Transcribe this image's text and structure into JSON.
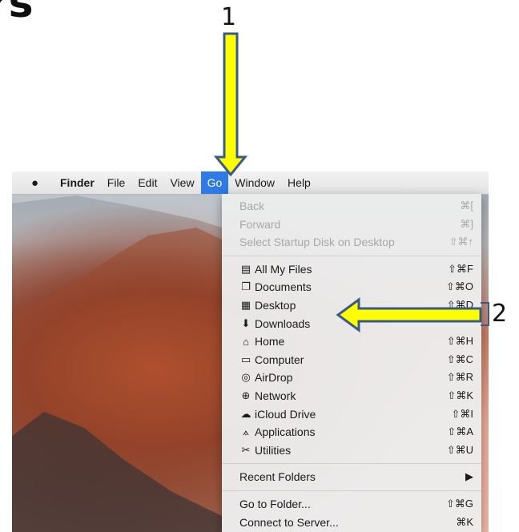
{
  "heading_fragment": "rs",
  "menubar": {
    "apple_icon": "apple-logo-icon",
    "items": [
      {
        "label": "Finder",
        "bold": true
      },
      {
        "label": "File"
      },
      {
        "label": "Edit"
      },
      {
        "label": "View"
      },
      {
        "label": "Go",
        "active": true
      },
      {
        "label": "Window"
      },
      {
        "label": "Help"
      }
    ]
  },
  "go_menu": {
    "items": [
      {
        "label": "Back",
        "shortcut": "⌘[",
        "disabled": true
      },
      {
        "label": "Forward",
        "shortcut": "⌘]",
        "disabled": true
      },
      {
        "label": "Select Startup Disk on Desktop",
        "shortcut": "⇧⌘↑",
        "disabled": true
      },
      {
        "separator": true
      },
      {
        "label": "All My Files",
        "shortcut": "⇧⌘F",
        "icon": "all-files-icon",
        "glyph": "▤"
      },
      {
        "label": "Documents",
        "shortcut": "⇧⌘O",
        "icon": "documents-icon",
        "glyph": "❐"
      },
      {
        "label": "Desktop",
        "shortcut": "⇧⌘D",
        "icon": "desktop-icon",
        "glyph": "▦"
      },
      {
        "label": "Downloads",
        "shortcut": "",
        "icon": "downloads-icon",
        "glyph": "⬇"
      },
      {
        "label": "Home",
        "shortcut": "⇧⌘H",
        "icon": "home-icon",
        "glyph": "⌂"
      },
      {
        "label": "Computer",
        "shortcut": "⇧⌘C",
        "icon": "computer-icon",
        "glyph": "▭"
      },
      {
        "label": "AirDrop",
        "shortcut": "⇧⌘R",
        "icon": "airdrop-icon",
        "glyph": "◎"
      },
      {
        "label": "Network",
        "shortcut": "⇧⌘K",
        "icon": "network-icon",
        "glyph": "⊕"
      },
      {
        "label": "iCloud Drive",
        "shortcut": "⇧⌘I",
        "icon": "cloud-icon",
        "glyph": "☁"
      },
      {
        "label": "Applications",
        "shortcut": "⇧⌘A",
        "icon": "applications-icon",
        "glyph": "⟑"
      },
      {
        "label": "Utilities",
        "shortcut": "⇧⌘U",
        "icon": "utilities-icon",
        "glyph": "✂"
      },
      {
        "separator": true
      },
      {
        "label": "Recent Folders",
        "shortcut": "▶",
        "submenu": true
      },
      {
        "separator": true
      },
      {
        "label": "Go to Folder...",
        "shortcut": "⇧⌘G"
      },
      {
        "label": "Connect to Server...",
        "shortcut": "⌘K"
      }
    ]
  },
  "annotations": {
    "step1": "1",
    "step2": "2",
    "arrow_color": "#ffff00",
    "arrow_outline": "#3a5a8c"
  }
}
